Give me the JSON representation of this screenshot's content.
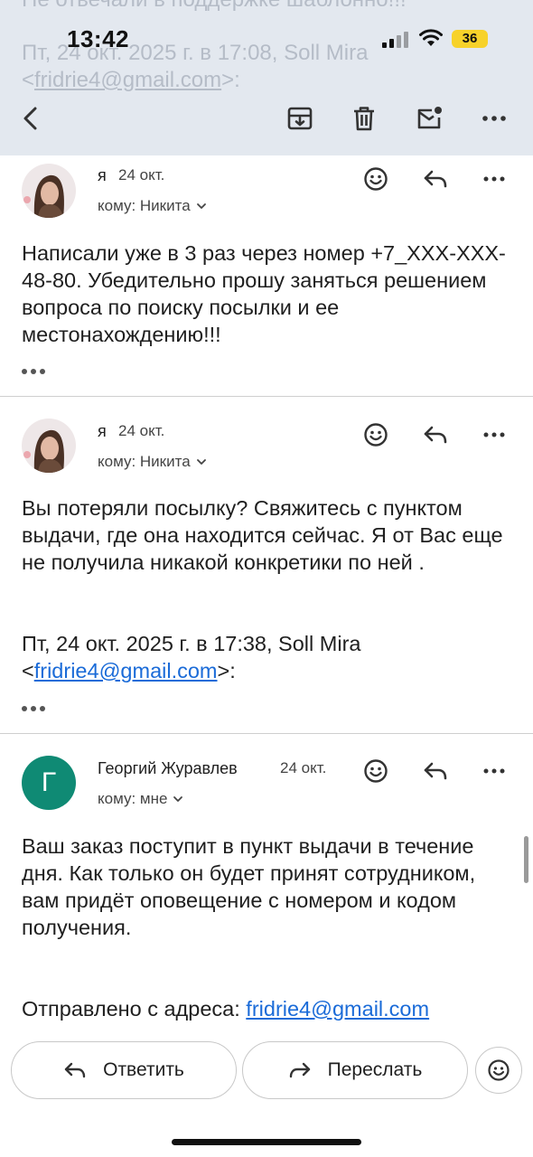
{
  "status_bar": {
    "time": "13:42",
    "battery": "36"
  },
  "header": {
    "ghost_line1": "Не отвечали в поддержке шаблонно!!!",
    "ghost_line2": "Пт, 24 окт. 2025 г. в 17:08, Soll Mira",
    "ghost_line3_prefix": "<",
    "ghost_line3_email": "fridrie4@gmail.com",
    "ghost_line3_suffix": ">:",
    "icons": [
      "back-icon",
      "archive-icon",
      "trash-icon",
      "mark-unread-icon",
      "more-icon"
    ]
  },
  "messages": [
    {
      "sender": "я",
      "date": "24 окт.",
      "to": "кому: Никита",
      "body": "Написали уже в 3 раз через номер +7_XXX-XXX-48-80. Убедительно прошу заняться решением вопроса по поиску посылки и ее местонахождению!!!"
    },
    {
      "sender": "я",
      "date": "24 окт.",
      "to": "кому: Никита",
      "body": "Вы потеряли посылку? Свяжитесь с пунктом выдачи, где она находится сейчас. Я от Вас еще не получила никакой конкретики по ней .",
      "quote_line": "Пт, 24 окт. 2025 г. в 17:38, Soll Mira",
      "quote_prefix": "<",
      "quote_email": "fridrie4@gmail.com",
      "quote_suffix": ">:"
    },
    {
      "sender": "Георгий Журавлев",
      "avatar_letter": "Г",
      "avatar_color": "#0f8a74",
      "date": "24 окт.",
      "to": "кому: мне",
      "body": "Ваш заказ поступит в пункт выдачи в течение дня. Как только он будет принят сотрудником, вам придёт оповещение с номером и кодом получения.",
      "sent_from_label": "Отправлено с адреса:",
      "sent_from_email": "fridrie4@gmail.com"
    }
  ],
  "bottom_bar": {
    "reply_label": "Ответить",
    "forward_label": "Переслать"
  },
  "colors": {
    "header_bg": "#e3e8ef",
    "link": "#1a6bd8",
    "avatar_green": "#0f8a74",
    "battery": "#f7d22a"
  }
}
